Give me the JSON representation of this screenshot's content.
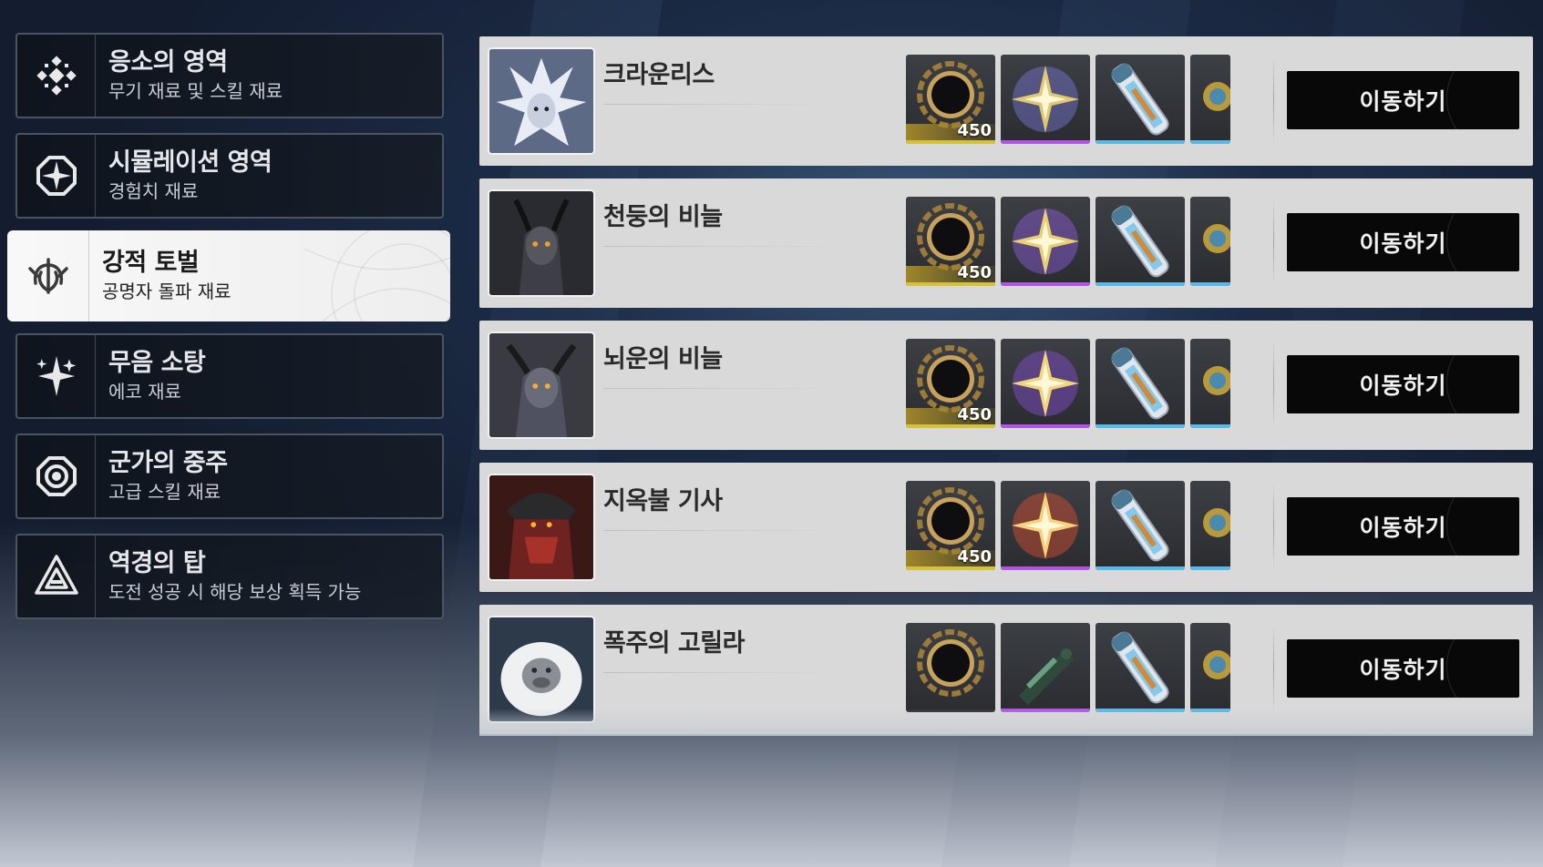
{
  "sidebar": {
    "items": [
      {
        "title": "응소의 영역",
        "sub": "무기 재료 및 스킬 재료",
        "icon": "diamond-cross-icon",
        "active": false
      },
      {
        "title": "시뮬레이션 영역",
        "sub": "경험치 재료",
        "icon": "octagon-compass-icon",
        "active": false
      },
      {
        "title": "강적 토벌",
        "sub": "공명자 돌파 재료",
        "icon": "claw-crest-icon",
        "active": true
      },
      {
        "title": "무음 소탕",
        "sub": "에코 재료",
        "icon": "spark-star-icon",
        "active": false
      },
      {
        "title": "군가의 중주",
        "sub": "고급 스킬 재료",
        "icon": "concentric-ring-icon",
        "active": false
      },
      {
        "title": "역경의 탑",
        "sub": "도전 성공 시 해당 보상 획득 가능",
        "icon": "triangle-tower-icon",
        "active": false
      }
    ]
  },
  "bosses": [
    {
      "name": "크라운리스",
      "button": "이동하기",
      "portrait": "crownless-portrait",
      "crystal_color": "#e0c870",
      "crystal_glow": "#7a7ad8",
      "shard_qty": "450"
    },
    {
      "name": "천둥의 비늘",
      "button": "이동하기",
      "portrait": "thundering-mephis-portrait",
      "crystal_color": "#e8d070",
      "crystal_glow": "#9060e0",
      "shard_qty": "450"
    },
    {
      "name": "뇌운의 비늘",
      "button": "이동하기",
      "portrait": "tempest-mephis-portrait",
      "crystal_color": "#f0d47a",
      "crystal_glow": "#8a50d8",
      "shard_qty": "450"
    },
    {
      "name": "지옥불 기사",
      "button": "이동하기",
      "portrait": "inferno-rider-portrait",
      "crystal_color": "#f3d27a",
      "crystal_glow": "#e05030",
      "shard_qty": "450"
    },
    {
      "name": "폭주의 고릴라",
      "button": "이동하기",
      "portrait": "lampylumen-portrait",
      "crystal_color": "#6aa080",
      "crystal_glow": "#3a6a50",
      "shard_qty": ""
    }
  ],
  "colors": {
    "bar_gold": "#d6c23a",
    "bar_purple": "#b255e6",
    "bar_blue": "#58b8e8",
    "row_bg": "#d9d9d9",
    "button_bg": "#080808"
  }
}
